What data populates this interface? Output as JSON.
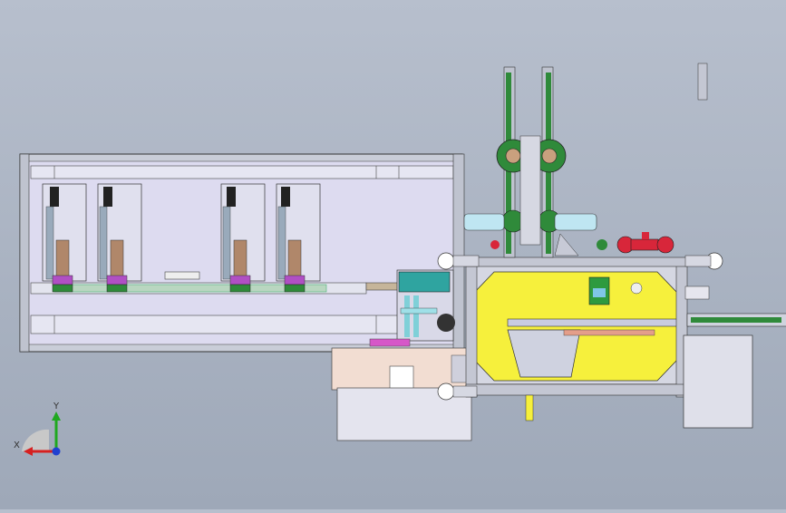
{
  "viewport": {
    "background_top": "#b7bfcd",
    "background_bottom": "#9ea8b8"
  },
  "model": {
    "frame_color": "#cfd3de",
    "panel_color": "#dcd9f0",
    "yellow_plate_color": "#f6f03c",
    "green_part_color": "#2f8a3a",
    "red_part_color": "#d8263a",
    "cylinder_color": "#bfe6f2",
    "brown_part_color": "#b0876a"
  },
  "triad": {
    "x_label": "X",
    "y_label": "Y",
    "x_color": "#d62020",
    "y_color": "#1fa81f",
    "z_color": "#2040d0"
  }
}
